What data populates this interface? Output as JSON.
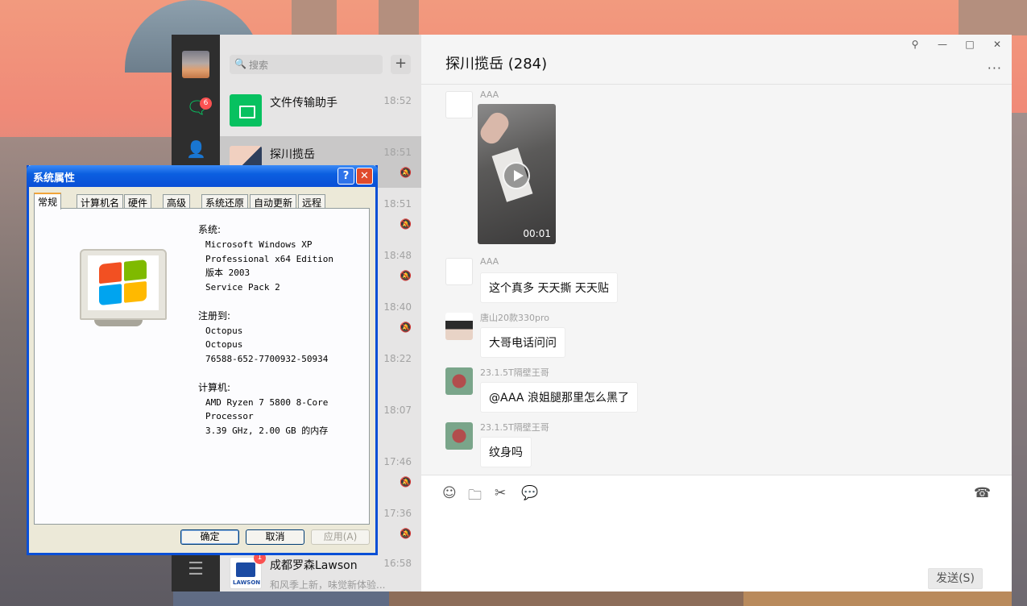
{
  "wechat": {
    "nav": {
      "chat_badge": "6"
    },
    "search": {
      "placeholder": "搜索"
    },
    "add_label": "+",
    "conversations": [
      {
        "name": "文件传输助手",
        "time": "18:52",
        "preview": "",
        "muted": false
      },
      {
        "name": "探川揽岳",
        "time": "18:51",
        "preview": "",
        "muted": true,
        "active": true
      },
      {
        "name": "",
        "time": "18:51",
        "preview": "",
        "muted": true
      },
      {
        "name": "",
        "time": "18:48",
        "preview": "",
        "muted": true
      },
      {
        "name": "",
        "time": "18:40",
        "preview": "",
        "muted": true
      },
      {
        "name": "",
        "time": "18:22",
        "preview": "",
        "muted": false
      },
      {
        "name": "",
        "time": "18:07",
        "preview": "",
        "muted": false
      },
      {
        "name": "",
        "time": "17:46",
        "preview": "",
        "muted": true
      },
      {
        "name": "",
        "time": "17:36",
        "preview": "",
        "muted": true
      },
      {
        "name": "成都罗森Lawson",
        "time": "16:58",
        "preview": "和风季上新，味觉新体验...",
        "badge": "1"
      }
    ],
    "chat": {
      "title": "探川揽岳 (284)",
      "more": "···",
      "messages": [
        {
          "sender": "AAA",
          "type": "video",
          "duration": "00:01"
        },
        {
          "sender": "AAA",
          "text": "这个真多  天天撕 天天贴"
        },
        {
          "sender": "唐山20款330pro",
          "text": "大哥电话问问"
        },
        {
          "sender": "23.1.5T隔壁王哥",
          "text": "@AAA 浪姐腿那里怎么黑了"
        },
        {
          "sender": "23.1.5T隔壁王哥",
          "text": "纹身吗"
        }
      ],
      "send_label": "发送(S)"
    },
    "window_controls": {
      "pin": "⚲",
      "minimize": "—",
      "maximize": "□",
      "close": "✕"
    },
    "lawson_logo_text": "LAWSON"
  },
  "xp_dialog": {
    "title": "系统属性",
    "help": "?",
    "close": "✕",
    "tabs": [
      "常规",
      "计算机名",
      "硬件",
      "高级",
      "系统还原",
      "自动更新",
      "远程"
    ],
    "system_heading": "系统:",
    "system_lines": [
      "Microsoft Windows XP",
      "Professional x64 Edition",
      "版本 2003",
      "Service Pack 2"
    ],
    "registered_heading": "注册到:",
    "registered_lines": [
      "Octopus",
      "Octopus",
      "76588-652-7700932-50934"
    ],
    "computer_heading": "计算机:",
    "computer_lines": [
      "AMD Ryzen 7 5800 8-Core",
      "Processor",
      "3.39 GHz, 2.00 GB 的内存"
    ],
    "ok_label": "确定",
    "cancel_label": "取消",
    "apply_label": "应用(A)"
  }
}
